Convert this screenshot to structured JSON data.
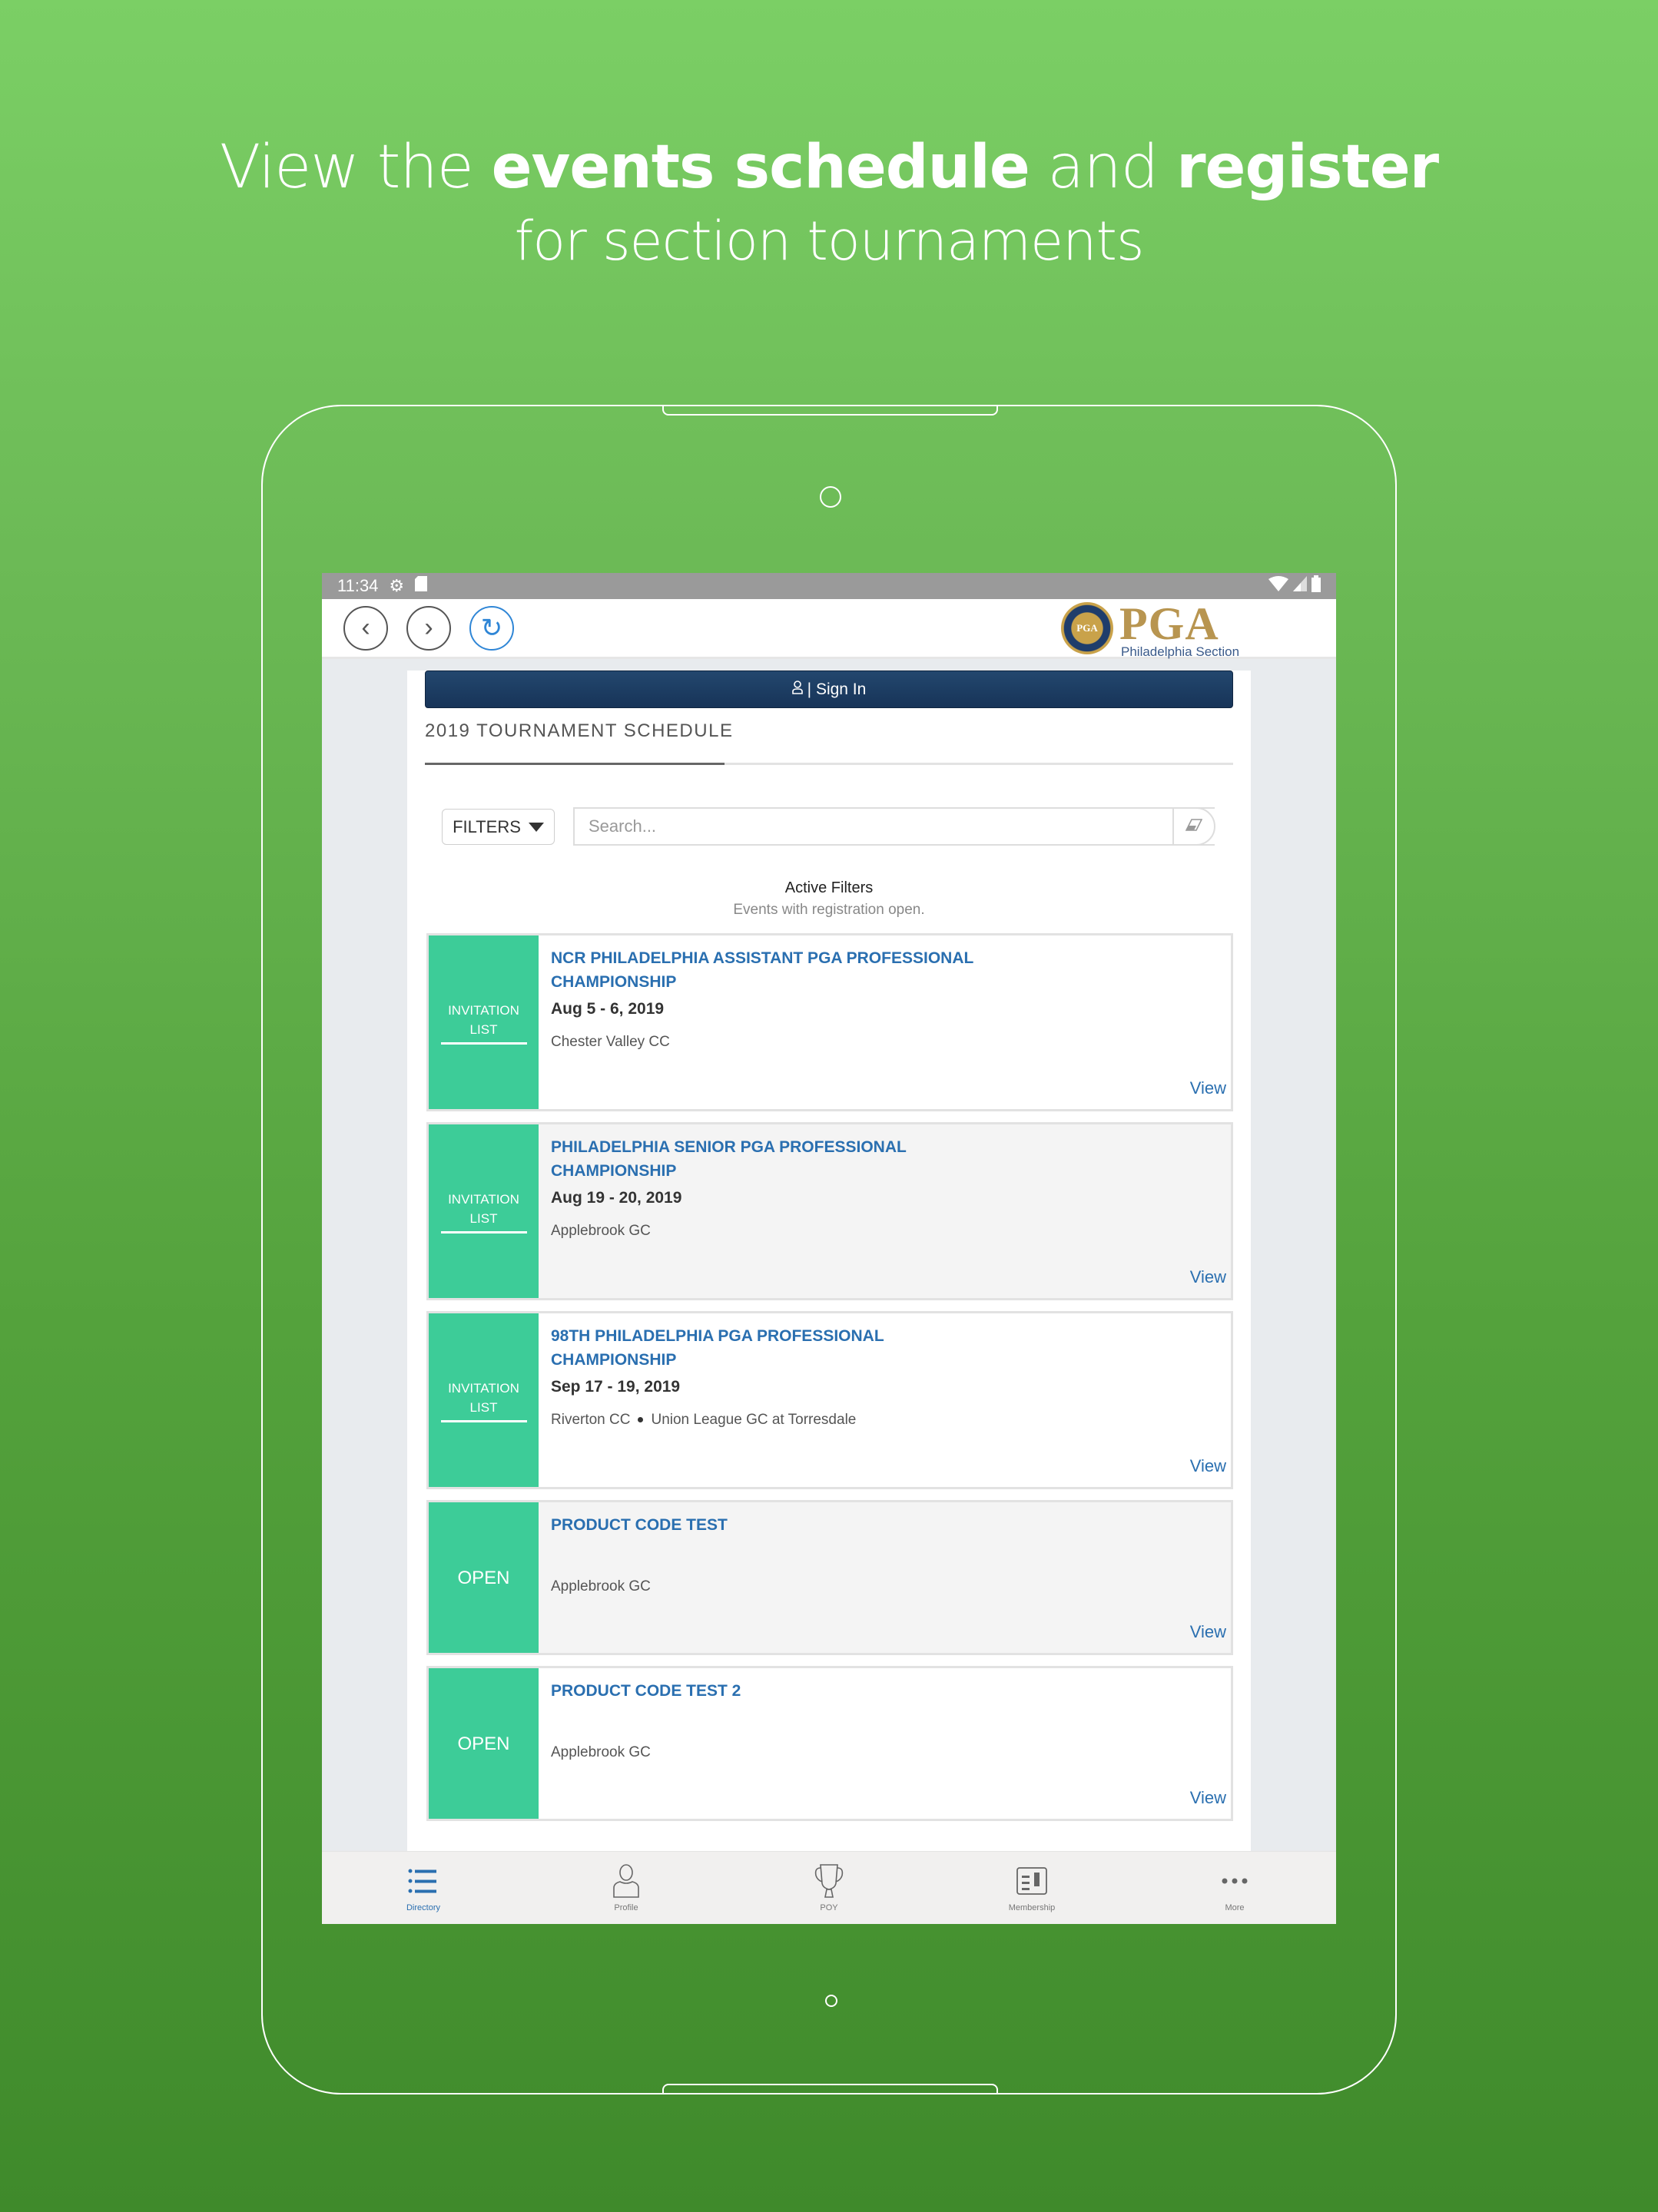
{
  "headline": {
    "line1_pre": "View the ",
    "line1_bold1": "events schedule",
    "line1_mid": " and ",
    "line1_bold2": "register",
    "line2": "for section tournaments"
  },
  "statusbar": {
    "time": "11:34",
    "icons": [
      "gear-icon",
      "sd-card-icon",
      "wifi-icon",
      "signal-icon",
      "battery-icon"
    ]
  },
  "navbar": {
    "back_icon": "‹",
    "forward_icon": "›",
    "refresh_icon": "↻",
    "logo_word": "PGA",
    "logo_subtitle": "Philadelphia Section",
    "seal_text": "PGA"
  },
  "signin": {
    "icon": "user-icon",
    "label": "| Sign In"
  },
  "schedule": {
    "title": "2019 TOURNAMENT SCHEDULE",
    "filters_label": "FILTERS",
    "search_placeholder": "Search...",
    "search_value": "",
    "active_filters_title": "Active Filters",
    "active_filters_desc": "Events with registration open."
  },
  "events": [
    {
      "badge_line1": "INVITATION",
      "badge_line2": "LIST",
      "title": "NCR PHILADELPHIA ASSISTANT PGA PROFESSIONAL CHAMPIONSHIP",
      "date": "Aug 5 - 6, 2019",
      "venues": [
        "Chester Valley CC"
      ],
      "view_label": "View"
    },
    {
      "badge_line1": "INVITATION",
      "badge_line2": "LIST",
      "title": "PHILADELPHIA SENIOR PGA PROFESSIONAL CHAMPIONSHIP",
      "date": "Aug 19 - 20, 2019",
      "venues": [
        "Applebrook GC"
      ],
      "view_label": "View"
    },
    {
      "badge_line1": "INVITATION",
      "badge_line2": "LIST",
      "title": "98TH PHILADELPHIA PGA PROFESSIONAL CHAMPIONSHIP",
      "date": "Sep 17 - 19, 2019",
      "venues": [
        "Riverton CC",
        "Union League GC at Torresdale"
      ],
      "view_label": "View"
    },
    {
      "badge_line1": "OPEN",
      "title": "PRODUCT CODE TEST",
      "date": "",
      "venues": [
        "Applebrook GC"
      ],
      "view_label": "View"
    },
    {
      "badge_line1": "OPEN",
      "title": "PRODUCT CODE TEST 2",
      "date": "",
      "venues": [
        "Applebrook GC"
      ],
      "view_label": "View"
    }
  ],
  "tabbar": {
    "items": [
      {
        "label": "Directory",
        "icon": "list-icon",
        "active": true
      },
      {
        "label": "Profile",
        "icon": "person-icon",
        "active": false
      },
      {
        "label": "POY",
        "icon": "trophy-icon",
        "active": false
      },
      {
        "label": "Membership",
        "icon": "membership-card-icon",
        "active": false
      },
      {
        "label": "More",
        "icon": "more-dots-icon",
        "active": false
      }
    ]
  },
  "colors": {
    "badge_green": "#3dcc98",
    "link_blue": "#2a6fb0",
    "signin_navy": "#1d3d63",
    "logo_gold": "#b89550",
    "bg_green_top": "#7bcf65",
    "bg_green_bottom": "#3f8a2b"
  }
}
